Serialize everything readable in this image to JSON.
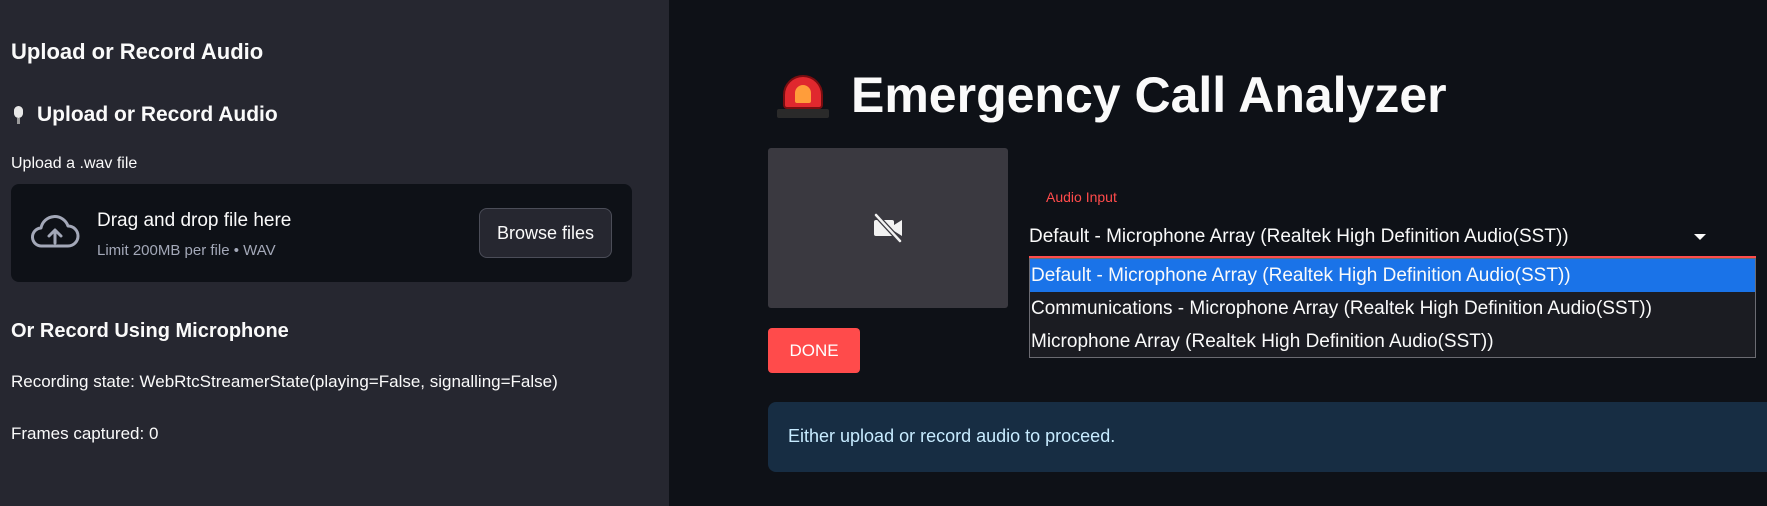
{
  "sidebar": {
    "heading": "Upload or Record Audio",
    "subheading": "Upload or Record Audio",
    "upload_label": "Upload a .wav file",
    "dropzone": {
      "title": "Drag and drop file here",
      "subtitle": "Limit 200MB per file • WAV",
      "browse_label": "Browse files"
    },
    "record_heading": "Or Record Using Microphone",
    "recording_state": "Recording state: WebRtcStreamerState(playing=False, signalling=False)",
    "frames_captured": "Frames captured: 0"
  },
  "main": {
    "title": "Emergency Call Analyzer",
    "done_label": "DONE",
    "audio_input": {
      "label": "Audio Input",
      "selected": "Default - Microphone Array (Realtek High Definition Audio(SST))",
      "options": [
        "Default - Microphone Array (Realtek High Definition Audio(SST))",
        "Communications - Microphone Array (Realtek High Definition Audio(SST))",
        "Microphone Array (Realtek High Definition Audio(SST))"
      ]
    },
    "info_message": "Either upload or record audio to proceed."
  },
  "icons": {
    "mic": "microphone-icon",
    "upload": "cloud-upload-icon",
    "video_off": "video-off-icon",
    "siren": "siren-icon",
    "dropdown": "chevron-down-icon"
  },
  "colors": {
    "sidebar_bg": "#262730",
    "main_bg": "#0e1117",
    "accent": "#ff4b4b",
    "selected_option": "#1a73e8",
    "info_bg": "#172d43",
    "info_text": "#c7ebff"
  }
}
